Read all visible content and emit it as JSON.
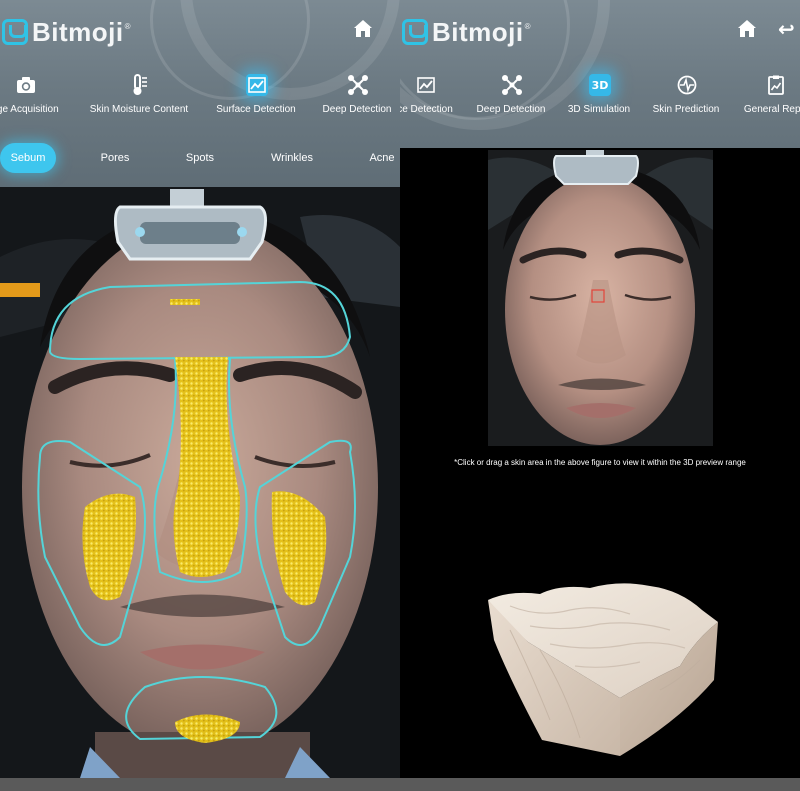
{
  "left": {
    "brand": {
      "name": "Bitmoji",
      "reg": "®"
    },
    "icons": {
      "home": "home-icon"
    },
    "nav": [
      {
        "label": "age Acquisition",
        "icon": "camera-icon",
        "active": false
      },
      {
        "label": "Skin Moisture Content",
        "icon": "thermometer-icon",
        "active": false
      },
      {
        "label": "Surface Detection",
        "icon": "chart-line-icon",
        "active": true
      },
      {
        "label": "Deep Detection",
        "icon": "network-icon",
        "active": false
      }
    ],
    "subtabs": [
      {
        "label": "Sebum",
        "active": true
      },
      {
        "label": "Pores",
        "active": false
      },
      {
        "label": "Spots",
        "active": false
      },
      {
        "label": "Wrinkles",
        "active": false
      },
      {
        "label": "Acne",
        "active": false
      }
    ]
  },
  "right": {
    "brand": {
      "name": "Bitmoji",
      "reg": "®"
    },
    "icons": {
      "home": "home-icon",
      "back": "back-arrow-icon"
    },
    "nav": [
      {
        "label": "ce Detection",
        "icon": "chart-line-icon",
        "active": false
      },
      {
        "label": "Deep Detection",
        "icon": "network-icon",
        "active": false
      },
      {
        "label": "3D Simulation",
        "icon": "3d-icon",
        "active": true
      },
      {
        "label": "Skin Prediction",
        "icon": "pulse-icon",
        "active": false
      },
      {
        "label": "General Repo",
        "icon": "report-icon",
        "active": false
      }
    ],
    "instruction": "*Click or drag a skin area in the above figure to view it within the 3D preview range"
  },
  "colors": {
    "header": "#6e7c85",
    "accent": "#3ec6ee",
    "sebum_overlay": "#f2d21b",
    "zone_outline": "#54d4d8"
  }
}
